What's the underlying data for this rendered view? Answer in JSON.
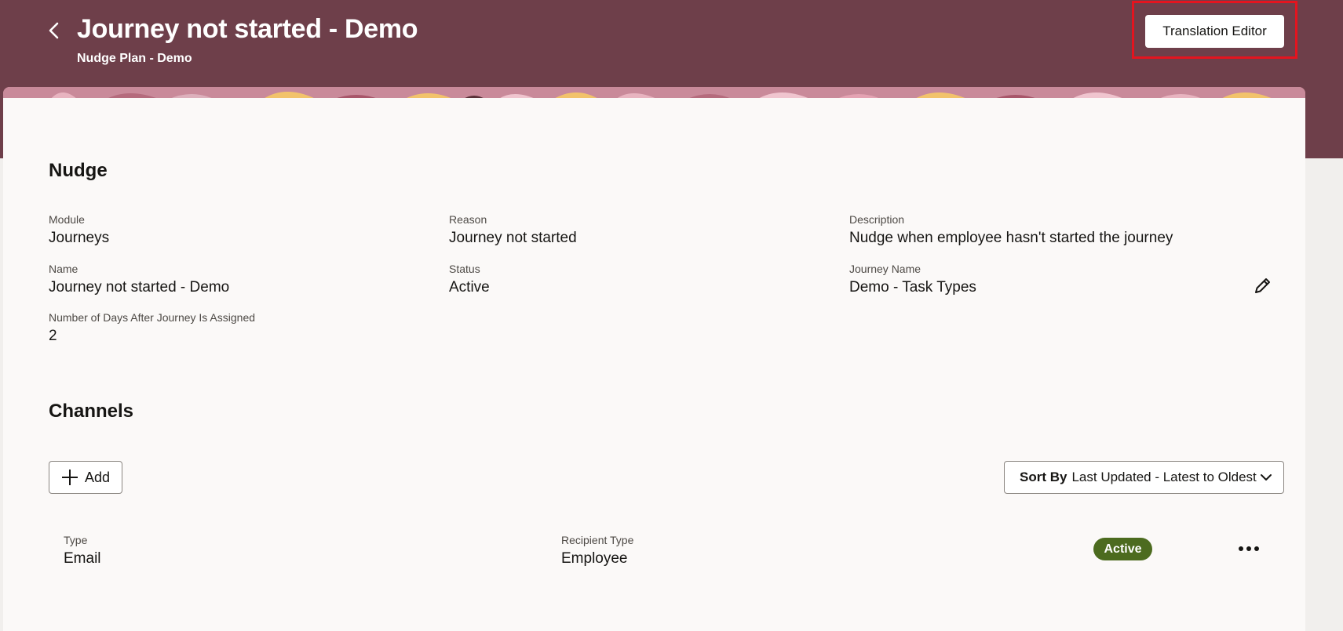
{
  "header": {
    "title": "Journey not started - Demo",
    "subtitle": "Nudge Plan - Demo",
    "translation_button": "Translation Editor",
    "back_icon": "chevron-left-icon"
  },
  "nudge": {
    "section_title": "Nudge",
    "fields": {
      "module": {
        "label": "Module",
        "value": "Journeys"
      },
      "reason": {
        "label": "Reason",
        "value": "Journey not started"
      },
      "description": {
        "label": "Description",
        "value": "Nudge when employee hasn't started the journey"
      },
      "name": {
        "label": "Name",
        "value": "Journey not started - Demo"
      },
      "status": {
        "label": "Status",
        "value": "Active"
      },
      "journey_name": {
        "label": "Journey Name",
        "value": "Demo - Task Types"
      },
      "days": {
        "label": "Number of Days After Journey Is Assigned",
        "value": "2"
      }
    },
    "edit_icon": "pencil-icon"
  },
  "channels": {
    "section_title": "Channels",
    "add_label": "Add",
    "sort_label": "Sort By",
    "sort_value": "Last Updated - Latest to Oldest",
    "items": [
      {
        "type_label": "Type",
        "type_value": "Email",
        "recipient_label": "Recipient Type",
        "recipient_value": "Employee",
        "status": "Active"
      }
    ]
  },
  "colors": {
    "header_bg": "#6e3f4a",
    "highlight": "#e4141f",
    "active_badge": "#4c6b1f"
  }
}
